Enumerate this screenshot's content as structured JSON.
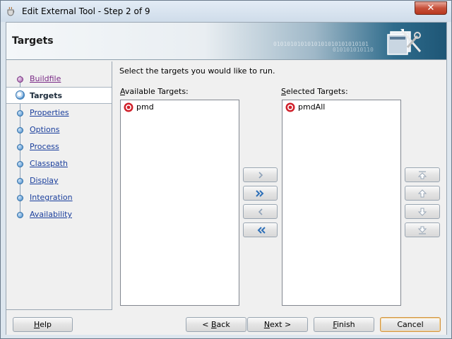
{
  "window": {
    "title": "Edit External Tool - Step 2 of 9",
    "close_glyph": "✕"
  },
  "header": {
    "title": "Targets",
    "binary_text": "0101010101010101010101010101",
    "binary_text2": "010101010110"
  },
  "nav": {
    "items": [
      {
        "label": "Buildfile",
        "state": "visited"
      },
      {
        "label": "Targets",
        "state": "current"
      },
      {
        "label": "Properties",
        "state": "link"
      },
      {
        "label": "Options",
        "state": "link"
      },
      {
        "label": "Process",
        "state": "link"
      },
      {
        "label": "Classpath",
        "state": "link"
      },
      {
        "label": "Display",
        "state": "link"
      },
      {
        "label": "Integration",
        "state": "link"
      },
      {
        "label": "Availability",
        "state": "link"
      }
    ]
  },
  "main": {
    "instruction": "Select the targets you would like to run.",
    "available": {
      "label_first": "A",
      "label_rest": "vailable Targets:",
      "items": [
        "pmd"
      ]
    },
    "selected": {
      "label_first": "S",
      "label_rest": "elected Targets:",
      "items": [
        "pmdAll"
      ]
    }
  },
  "buttons": {
    "help": {
      "pre": "",
      "mn": "H",
      "post": "elp"
    },
    "back": {
      "pre": "< ",
      "mn": "B",
      "post": "ack"
    },
    "next": {
      "pre": "",
      "mn": "N",
      "post": "ext >"
    },
    "finish": {
      "pre": "",
      "mn": "F",
      "post": "inish"
    },
    "cancel": {
      "pre": "",
      "mn": "",
      "post": "Cancel"
    }
  },
  "colors": {
    "accent": "#3d86c8",
    "banner_dark": "#1e5676",
    "target_icon": "#d0202a",
    "visited_link": "#7a2a86",
    "link": "#1a3e9c"
  },
  "icons": {
    "move_right": "chevron-right-icon",
    "move_all_right": "double-chevron-right-icon",
    "move_left": "chevron-left-icon",
    "move_all_left": "double-chevron-left-icon",
    "move_top": "move-to-top-icon",
    "move_up": "move-up-icon",
    "move_down": "move-down-icon",
    "move_bottom": "move-to-bottom-icon"
  }
}
